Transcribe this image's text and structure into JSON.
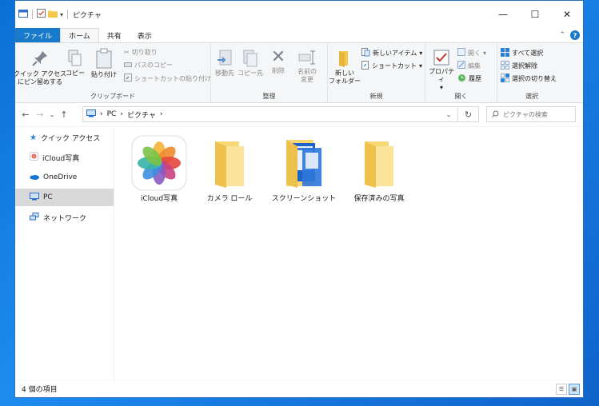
{
  "window": {
    "title": "ピクチャ",
    "tabs": {
      "file": "ファイル",
      "home": "ホーム",
      "share": "共有",
      "view": "表示"
    },
    "controls": {
      "minimize": "—",
      "maximize": "☐",
      "close": "✕"
    }
  },
  "ribbon": {
    "clipboard": {
      "group": "クリップボード",
      "pin": "クイック アクセス\nにピン留めする",
      "copy": "コピー",
      "paste": "貼り付け",
      "cut": "切り取り",
      "copy_path": "パスのコピー",
      "paste_shortcut": "ショートカットの貼り付け"
    },
    "organize": {
      "group": "整理",
      "move_to": "移動先",
      "copy_to": "コピー先",
      "delete": "削除",
      "rename": "名前の\n変更"
    },
    "new": {
      "group": "新規",
      "new_folder": "新しい\nフォルダー",
      "new_item": "新しいアイテム",
      "shortcut": "ショートカット"
    },
    "open": {
      "group": "開く",
      "properties": "プロパティ",
      "open": "開く",
      "edit": "編集",
      "history": "履歴"
    },
    "select": {
      "group": "選択",
      "select_all": "すべて選択",
      "select_none": "選択解除",
      "invert": "選択の切り替え"
    }
  },
  "address": {
    "path": [
      "PC",
      "ピクチャ"
    ],
    "search_placeholder": "ピクチャの検索"
  },
  "nav_pane": [
    {
      "label": "クイック アクセス",
      "icon": "star-icon"
    },
    {
      "label": "iCloud写真",
      "icon": "photos-icon"
    },
    {
      "label": "OneDrive",
      "icon": "cloud-icon"
    },
    {
      "label": "PC",
      "icon": "pc-icon",
      "selected": true
    },
    {
      "label": "ネットワーク",
      "icon": "network-icon"
    }
  ],
  "items": [
    {
      "label": "iCloud写真",
      "icon": "photos-app-icon"
    },
    {
      "label": "カメラ ロール",
      "icon": "folder-icon"
    },
    {
      "label": "スクリーンショット",
      "icon": "folder-open-icon"
    },
    {
      "label": "保存済みの写真",
      "icon": "folder-icon"
    }
  ],
  "status": {
    "count": "4 個の項目"
  }
}
